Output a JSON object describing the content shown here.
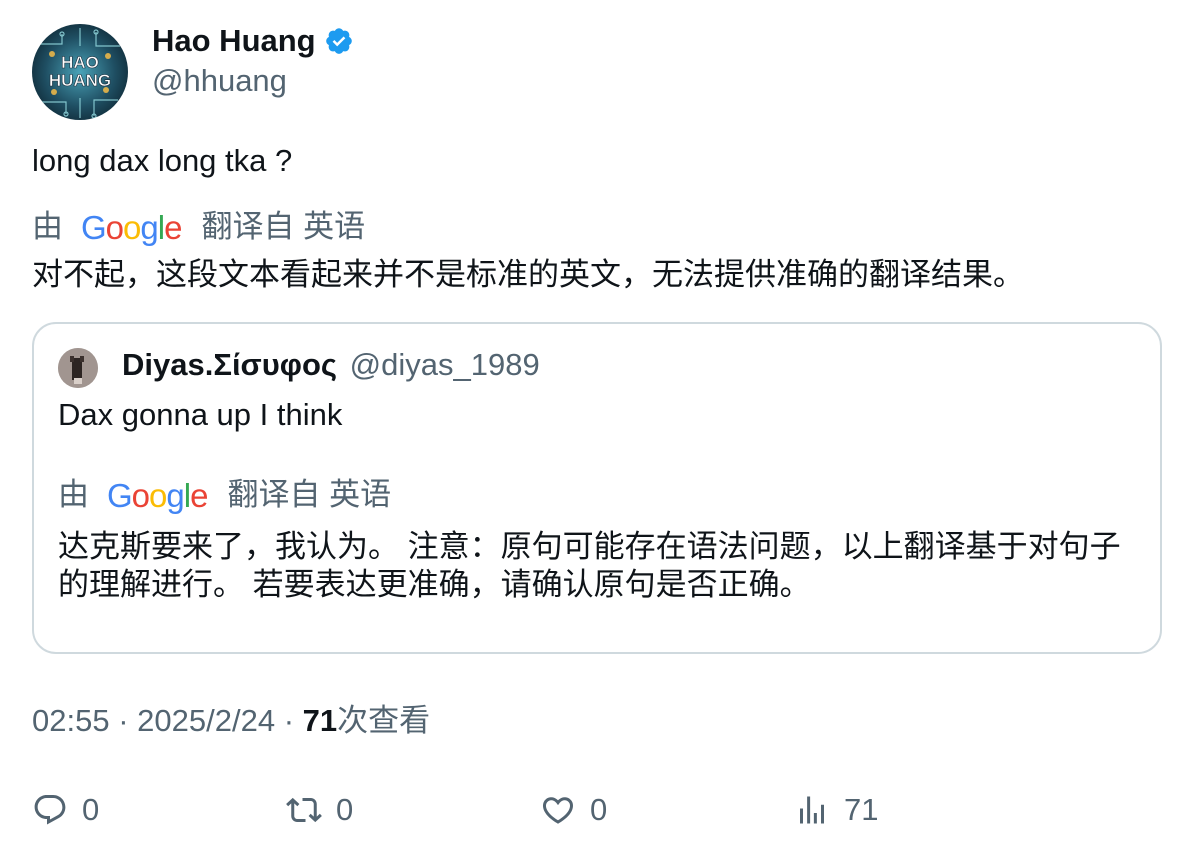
{
  "author": {
    "name": "Hao Huang",
    "handle": "@hhuang",
    "avatar_text_line1": "HAO",
    "avatar_text_line2": "HUANG"
  },
  "tweet": {
    "text": "long dax long tka ?",
    "translate_by": "由",
    "translate_label": "翻译自 英语",
    "translation": "对不起，这段文本看起来并不是标准的英文，无法提供准确的翻译结果。"
  },
  "quote": {
    "name": "Diyas.Σίσυφος",
    "handle": "@diyas_1989",
    "text": "Dax gonna up I think",
    "translate_by": "由",
    "translate_label": "翻译自 英语",
    "translation": "达克斯要来了，我认为。 注意：原句可能存在语法问题，以上翻译基于对句子的理解进行。 若要表达更准确，请确认原句是否正确。"
  },
  "meta": {
    "time": "02:55",
    "separator": "·",
    "date": "2025/2/24",
    "views_count": "71",
    "views_label": "次查看"
  },
  "actions": {
    "reply_count": "0",
    "retweet_count": "0",
    "like_count": "0",
    "views_count": "71"
  },
  "google_logo": {
    "letters": [
      "G",
      "o",
      "o",
      "g",
      "l",
      "e"
    ]
  },
  "colors": {
    "text": "#0f1419",
    "secondary": "#536471",
    "border": "#cfd9de",
    "verified": "#1d9bf0"
  }
}
